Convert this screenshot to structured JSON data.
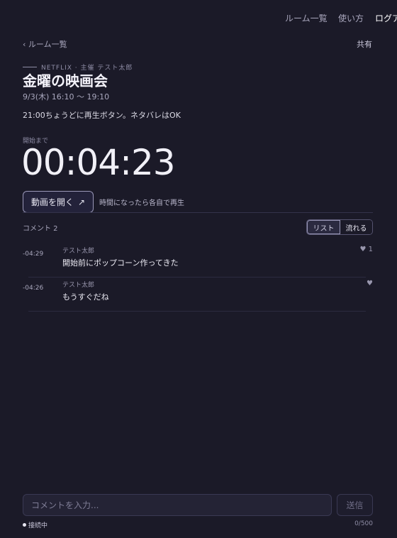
{
  "nav": {
    "rooms": "ルーム一覧",
    "howto": "使い方",
    "login": "ログア"
  },
  "header": {
    "back_label": "‹ ルーム一覧",
    "share_label": "共有"
  },
  "event": {
    "meta": "NETFLIX · 主催 テスト太郎",
    "title": "金曜の映画会",
    "datetime": "9/3(木) 16:10 〜 19:10",
    "note": "21:00ちょうどに再生ボタン。ネタバレはOK"
  },
  "countdown": {
    "label": "開始まで",
    "value": "00:04:23"
  },
  "actions": {
    "open_video_label": "動画を開く",
    "open_video_icon": "↗",
    "play_hint": "時間になったら各自で再生"
  },
  "comments": {
    "count_label": "コメント 2",
    "view_tabs": [
      "リスト",
      "流れる"
    ],
    "items": [
      {
        "time": "-04:29",
        "author": "テスト太郎",
        "text": "開始前にポップコーン作ってきた",
        "likes": "♥ 1"
      },
      {
        "time": "-04:26",
        "author": "テスト太郎",
        "text": "もうすぐだね",
        "likes": "♥"
      }
    ]
  },
  "composer": {
    "placeholder": "コメントを入力...",
    "value": "",
    "send_label": "送信",
    "status_label": "接続中",
    "char_count": "0/500"
  },
  "colors": {
    "background": "#1b1a28",
    "text": "#e9e8f0",
    "muted": "#a9a7bd",
    "border": "#3a3953"
  }
}
